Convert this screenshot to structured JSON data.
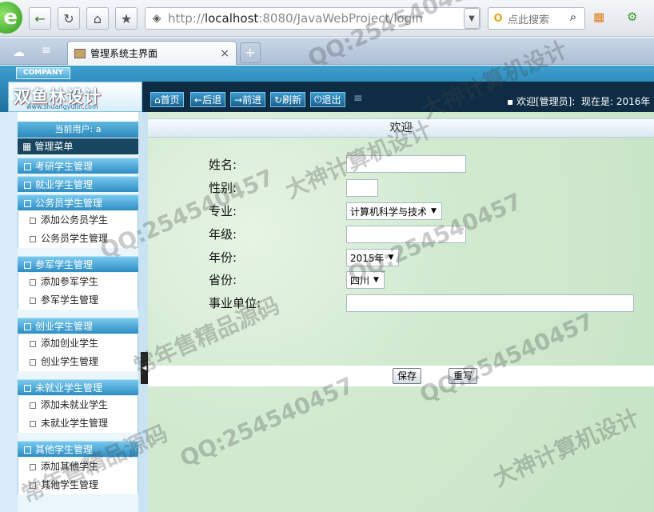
{
  "browser": {
    "address": {
      "scheme": "http://",
      "host": "localhost",
      "rest": ":8080/JavaWebProject/login"
    },
    "search_placeholder": "点此搜索",
    "tab": {
      "title": "管理系统主界面",
      "close": "×",
      "new_tab": "+"
    },
    "icons": [
      "back-arrow-icon",
      "refresh-icon",
      "home-icon",
      "star-icon",
      "shield-icon",
      "dropdown-icon",
      "search-icon",
      "apps-icon",
      "cloud-icon"
    ]
  },
  "header": {
    "company": "COMPANY",
    "logo": {
      "name": "双鱼林设计",
      "url": "www.shuangyulin.com"
    },
    "nav": [
      {
        "icon": "home-icon",
        "label": "首页"
      },
      {
        "icon": "back-icon",
        "label": "后退"
      },
      {
        "icon": "forward-icon",
        "label": "前进"
      },
      {
        "icon": "refresh-icon",
        "label": "刷新"
      },
      {
        "icon": "power-icon",
        "label": "退出"
      }
    ],
    "welcome": "欢迎[管理员]:",
    "now": "现在是: 2016年"
  },
  "sidebar": {
    "user": "当前用户: a",
    "menu_title": "管理菜单",
    "categories": [
      "考研学生管理",
      "就业学生管理",
      "公务员学生管理",
      "参军学生管理",
      "创业学生管理",
      "未就业学生管理",
      "其他学生管理"
    ],
    "subitems": [
      "添加公务员学生",
      "公务员学生管理",
      "添加参军学生",
      "参军学生管理",
      "添加创业学生",
      "创业学生管理",
      "添加未就业学生",
      "未就业学生管理",
      "添加其他学生",
      "其他学生管理"
    ]
  },
  "content": {
    "title": "欢迎",
    "labels": [
      "姓名:",
      "性别:",
      "专业:",
      "年级:",
      "年份:",
      "省份:",
      "事业单位:"
    ],
    "major": "计算机科学与技术",
    "year": "2015年",
    "province": "四川",
    "save": "保存",
    "reset": "重写"
  },
  "watermarks": [
    "QQ:254540457",
    "大神计算机设计",
    "常年售精品源码"
  ]
}
